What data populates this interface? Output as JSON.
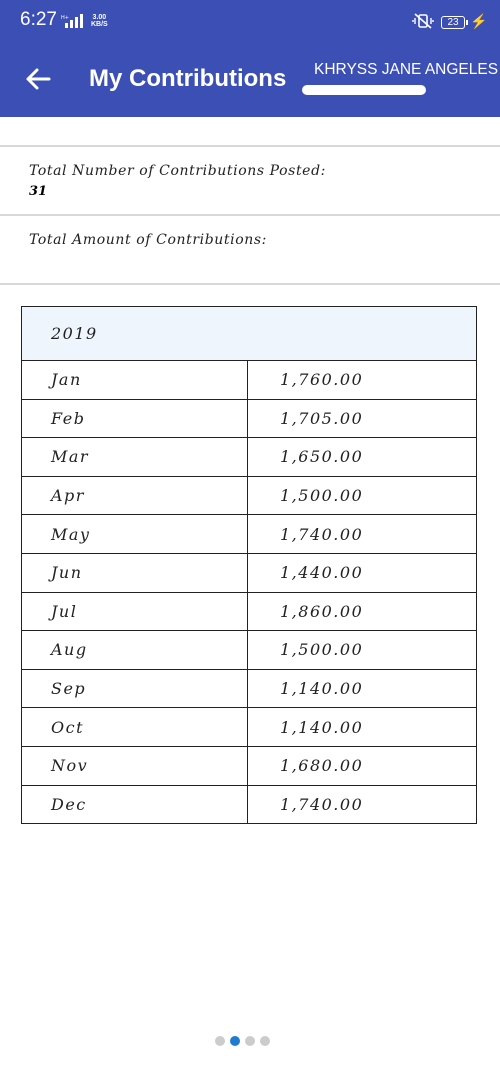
{
  "status_bar": {
    "time": "6:27",
    "network": "H+",
    "speed_value": "3.00",
    "speed_unit": "KB/S",
    "battery": "23"
  },
  "app_bar": {
    "title": "My Contributions",
    "user_name": "KHRYSS JANE ANGELES"
  },
  "summary": {
    "posted_label": "Total Number of Contributions Posted:",
    "posted_value": "31",
    "amount_label": "Total Amount of Contributions:"
  },
  "table": {
    "year": "2019",
    "rows": [
      {
        "month": "Jan",
        "amount": "1,760.00"
      },
      {
        "month": "Feb",
        "amount": "1,705.00"
      },
      {
        "month": "Mar",
        "amount": "1,650.00"
      },
      {
        "month": "Apr",
        "amount": "1,500.00"
      },
      {
        "month": "May",
        "amount": "1,740.00"
      },
      {
        "month": "Jun",
        "amount": "1,440.00"
      },
      {
        "month": "Jul",
        "amount": "1,860.00"
      },
      {
        "month": "Aug",
        "amount": "1,500.00"
      },
      {
        "month": "Sep",
        "amount": "1,140.00"
      },
      {
        "month": "Oct",
        "amount": "1,140.00"
      },
      {
        "month": "Nov",
        "amount": "1,680.00"
      },
      {
        "month": "Dec",
        "amount": "1,740.00"
      }
    ]
  },
  "pager": {
    "pages": 4,
    "active_index": 1
  },
  "colors": {
    "app_bar": "#3b4fb5",
    "active_dot": "#1f7ad1",
    "year_row_bg": "#eef5fd"
  },
  "icons": {
    "back": "arrow-left-icon",
    "vibrate": "vibrate-off-icon",
    "charging": "bolt-icon",
    "signal": "signal-icon"
  }
}
